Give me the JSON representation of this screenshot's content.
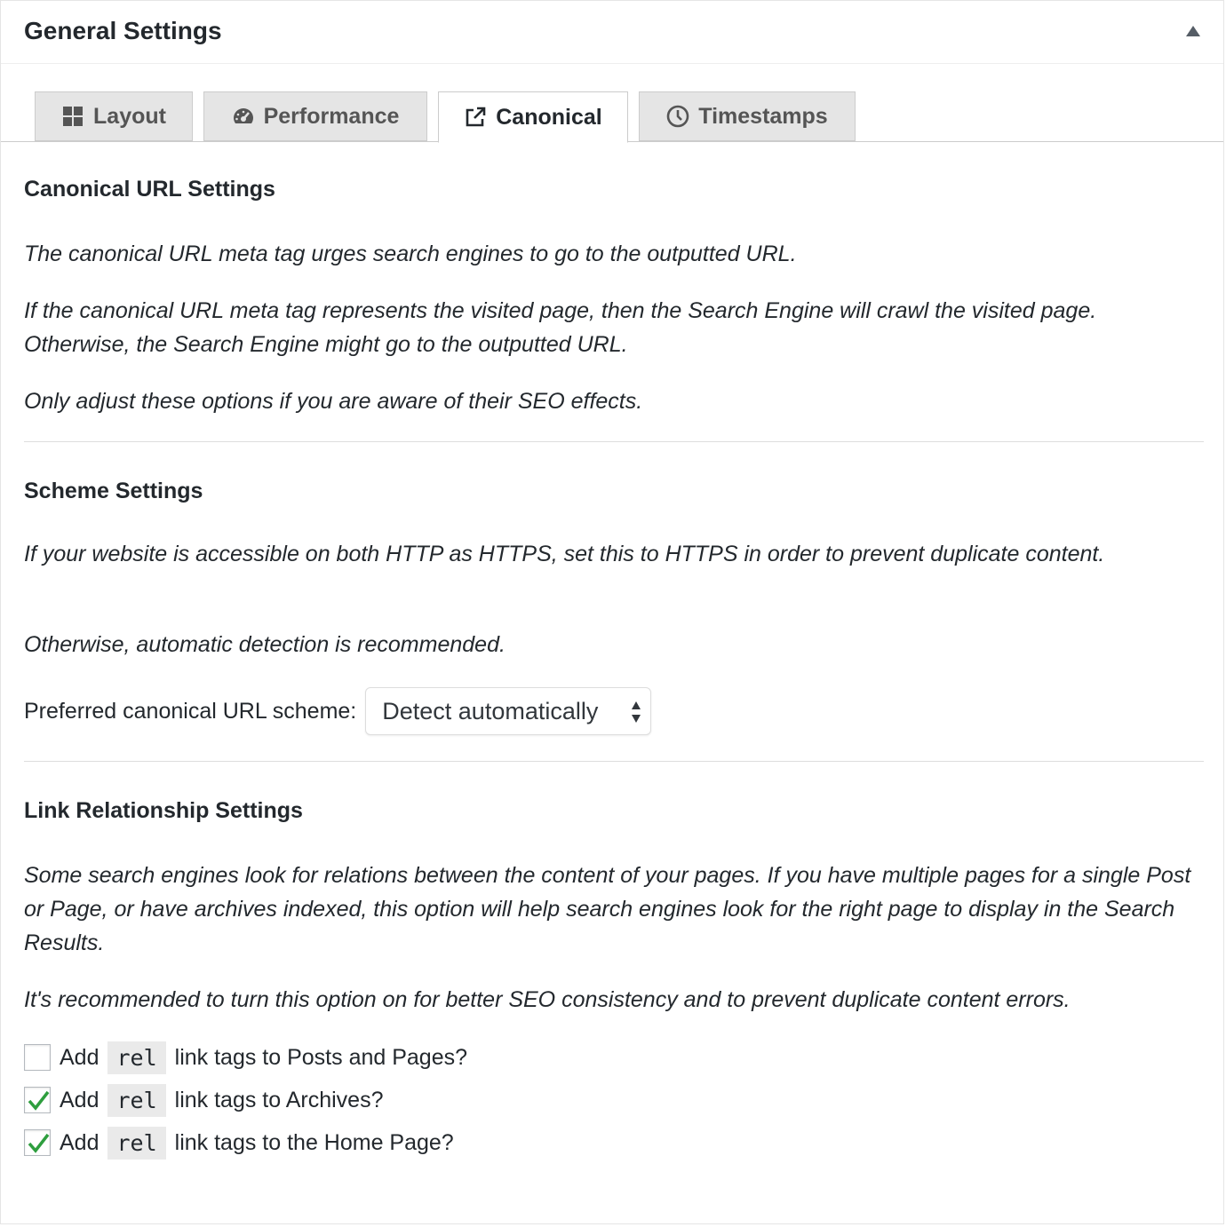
{
  "panel": {
    "title": "General Settings"
  },
  "tabs": [
    {
      "label": "Layout",
      "icon": "grid-icon",
      "active": false
    },
    {
      "label": "Performance",
      "icon": "dashboard-icon",
      "active": false
    },
    {
      "label": "Canonical",
      "icon": "external-link-icon",
      "active": true
    },
    {
      "label": "Timestamps",
      "icon": "clock-icon",
      "active": false
    }
  ],
  "canonical_section": {
    "title": "Canonical URL Settings",
    "desc_1": "The canonical URL meta tag urges search engines to go to the outputted URL.",
    "desc_2": "If the canonical URL meta tag represents the visited page, then the Search Engine will crawl the visited page. Otherwise, the Search Engine might go to the outputted URL.",
    "desc_3": "Only adjust these options if you are aware of their SEO effects."
  },
  "scheme_section": {
    "title": "Scheme Settings",
    "desc_1": "If your website is accessible on both HTTP as HTTPS, set this to HTTPS in order to prevent duplicate content.",
    "desc_2": "Otherwise, automatic detection is recommended.",
    "select_label": "Preferred canonical URL scheme:",
    "select_value": "Detect automatically"
  },
  "link_section": {
    "title": "Link Relationship Settings",
    "desc_1": "Some search engines look for relations between the content of your pages. If you have multiple pages for a single Post or Page, or have archives indexed, this option will help search engines look for the right page to display in the Search Results.",
    "desc_2": "It's recommended to turn this option on for better SEO consistency and to prevent duplicate content errors.",
    "options": [
      {
        "prefix": "Add",
        "code": "rel",
        "suffix": "link tags to Posts and Pages?",
        "checked": false
      },
      {
        "prefix": "Add",
        "code": "rel",
        "suffix": "link tags to Archives?",
        "checked": true
      },
      {
        "prefix": "Add",
        "code": "rel",
        "suffix": "link tags to the Home Page?",
        "checked": true
      }
    ]
  },
  "colors": {
    "check_green": "#1e8cbe",
    "checkmark": "#2e9e3e",
    "text": "#23282d",
    "tab_bg": "#e5e5e5"
  }
}
